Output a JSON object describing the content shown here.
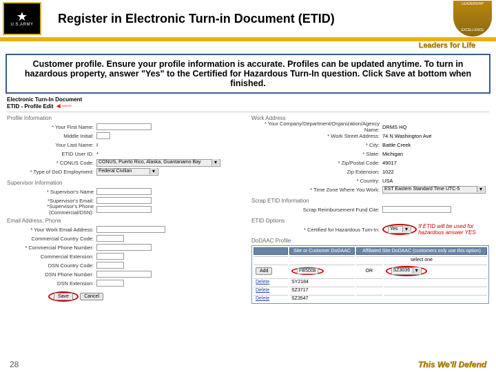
{
  "header": {
    "title": "Register in Electronic Turn-in Document (ETID)",
    "army_label": "U.S.ARMY"
  },
  "tagline_top": "Leaders for Life",
  "instruction": "Customer profile. Ensure your profile information is accurate. Profiles can be updated anytime. To turn in hazardous property, answer \"Yes\" to the Certified for Hazardous Turn-In question. Click Save at bottom when finished.",
  "doc_title1": "Electronic Turn-In Document",
  "doc_title2": "ETID - Profile Edit",
  "sections": {
    "profile": "Profile Information",
    "supervisor": "Supervisor Information",
    "contact": "Email Address, Phone",
    "work": "Work Address",
    "scrap": "Scrap ETID Information",
    "etidopt": "ETID Options",
    "dodaac": "DoDAAC Profile"
  },
  "left": {
    "first_lbl": "* Your First Name:",
    "mi_lbl": "Middle Initial:",
    "last_lbl": "Your Last Name:",
    "last": "I",
    "uid_lbl": "ETID User ID:",
    "uid": "*",
    "conus_lbl": "* CONUS Code:",
    "conus": "CONUS, Puerto Rico, Alaska, Guantanamo Bay",
    "emp_lbl": "* Type of DoD Employment:",
    "emp": "Federal Civilian",
    "sup_name_lbl": "* Supervisor's Name",
    "sup_email_lbl": "*Supervisor's Email:",
    "sup_phone_lbl": "*Supervisor's Phone (Commercial/DSN):",
    "email_lbl": "* Your Work Email Address:",
    "ccc_lbl": "Commercial Country Code:",
    "cphone_lbl": "* Commercial Phone Number:",
    "cext_lbl": "Commercial Extension:",
    "dcc_lbl": "DSN Country Code:",
    "dphone_lbl": "DSN Phone Number:",
    "dext_lbl": "DSN Extension:"
  },
  "right": {
    "org_lbl": "* Your Company/Department/Organization/Agency Name:",
    "org": "DRMS HQ",
    "street_lbl": "* Work Street Address:",
    "street": "74 N Washington Ave",
    "city_lbl": "* City:",
    "city": "Battle Creek",
    "state_lbl": "* State:",
    "state": "Michigan",
    "zip_lbl": "* Zip/Postal Code:",
    "zip": "49017",
    "zipext_lbl": "Zip Extension:",
    "zipext": "1022",
    "country_lbl": "* Country:",
    "country": "USA",
    "tz_lbl": "* Time Zone Where You Work:",
    "tz": "EST Eastern Standard Time UTC-5",
    "scrap_lbl": "Scrap Reimbursement Fund Cite:",
    "cert_lbl": "* Certified for Hazardous Turn-In:",
    "cert": "Yes",
    "cert_note": "If ETID will be used for hazardous answer YES"
  },
  "table": {
    "h1": "Site or Customer DoDAAC",
    "h2": "Affiliated Site DoDAAC (customers only use this option)",
    "select_one": "select one",
    "or": "OR",
    "add": "Add",
    "delete": "Delete",
    "primary": "FB5008",
    "affiliated": "SZ3036",
    "rows": [
      "SY2184",
      "SZ3717",
      "SZ3547"
    ]
  },
  "save": "Save",
  "cancel": "Cancel",
  "page": "28",
  "motto": "This We'll Defend"
}
